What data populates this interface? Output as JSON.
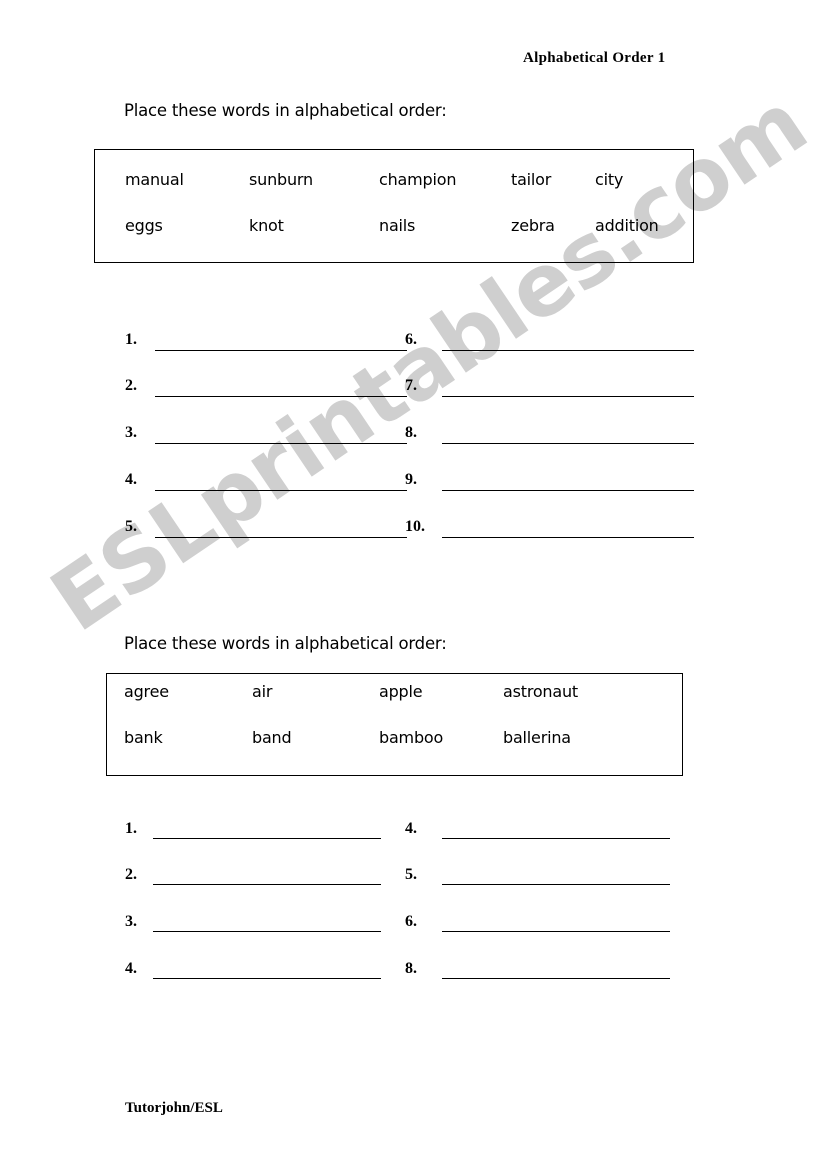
{
  "document": {
    "title": "Alphabetical Order 1",
    "footer": "Tutorjohn/ESL",
    "watermark": "ESLprintables.com",
    "watermark_color": "#cfcfcf",
    "text_color": "#000000",
    "background_color": "#ffffff"
  },
  "sections": [
    {
      "instruction": "Place these words in alphabetical order:",
      "word_box": {
        "rows": [
          [
            "manual",
            "sunburn",
            "champion",
            "tailor",
            "city"
          ],
          [
            "eggs",
            "knot",
            "nails",
            "zebra",
            "addition"
          ]
        ]
      },
      "answers": {
        "left_column": [
          "1.",
          "2.",
          "3.",
          "4.",
          "5."
        ],
        "right_column": [
          "6.",
          "7.",
          "8.",
          "9.",
          "10."
        ]
      }
    },
    {
      "instruction": "Place these words in alphabetical order:",
      "word_box": {
        "rows": [
          [
            "agree",
            "air",
            "apple",
            "astronaut"
          ],
          [
            "bank",
            "band",
            "bamboo",
            "ballerina"
          ]
        ]
      },
      "answers": {
        "left_column": [
          "1.",
          "2.",
          "3.",
          "4."
        ],
        "right_column": [
          "4.",
          "5.",
          "6.",
          "8."
        ]
      }
    }
  ]
}
